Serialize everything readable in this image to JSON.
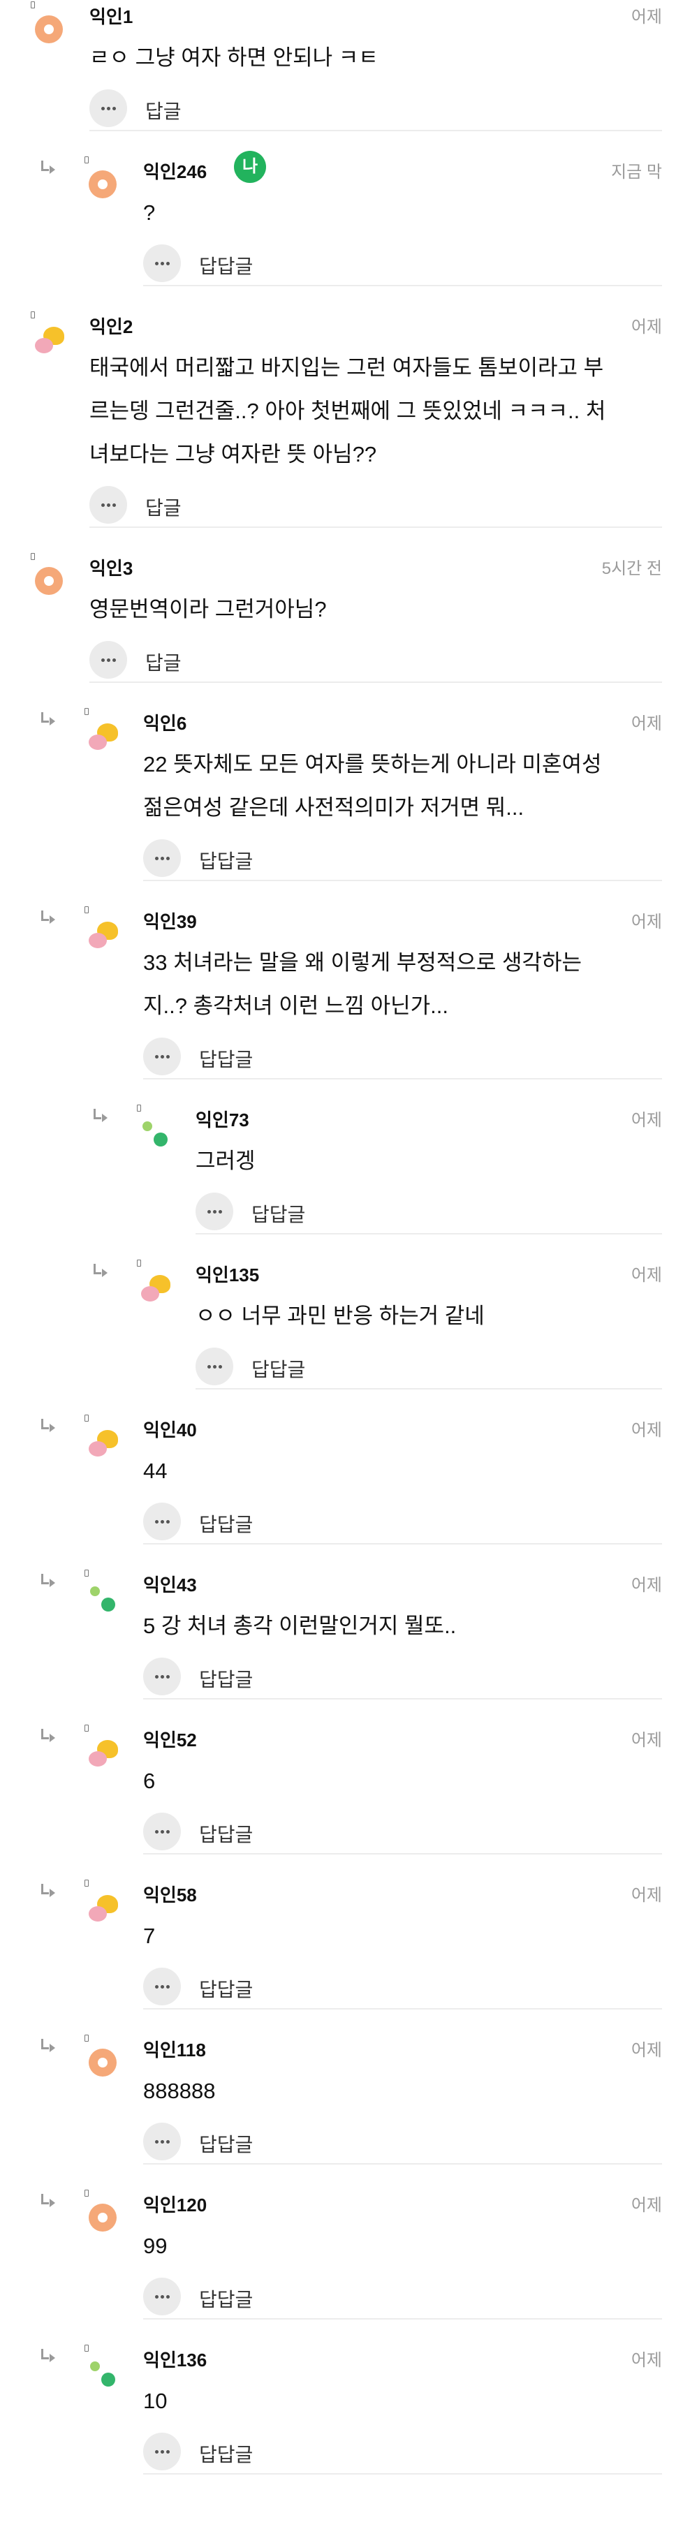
{
  "comments": [
    {
      "name": "익인1",
      "time": "어제",
      "lines": [
        "ㄹㅇ 그냥 여자 하면 안되나 ㅋㅌ"
      ],
      "level": 0,
      "avatar": "orange",
      "reply_label": "답글"
    },
    {
      "name": "익인246",
      "time": "지금 막",
      "lines": [
        "?"
      ],
      "level": 1,
      "avatar": "orange",
      "reply_label": "답답글",
      "badge": "나"
    },
    {
      "name": "익인2",
      "time": "어제",
      "lines": [
        "태국에서 머리짧고 바지입는 그런 여자들도 톰보이라고 부",
        "르는뎅 그런건줄..? 아아 첫번째에 그 뜻있었네 ㅋㅋㅋ.. 처",
        "녀보다는 그냥 여자란 뜻 아님??"
      ],
      "level": 0,
      "avatar": "yellow",
      "reply_label": "답글"
    },
    {
      "name": "익인3",
      "time": "5시간 전",
      "lines": [
        "영문번역이라 그런거아님?"
      ],
      "level": 0,
      "avatar": "orange",
      "reply_label": "답글"
    },
    {
      "name": "익인6",
      "time": "어제",
      "lines": [
        "22 뜻자체도 모든 여자를 뜻하는게 아니라 미혼여성",
        "젊은여성 같은데 사전적의미가 저거면 뭐..."
      ],
      "level": 1,
      "avatar": "yellow",
      "reply_label": "답답글"
    },
    {
      "name": "익인39",
      "time": "어제",
      "lines": [
        "33 처녀라는 말을 왜 이렇게 부정적으로 생각하는",
        "지..? 총각처녀 이런 느낌 아닌가..."
      ],
      "level": 1,
      "avatar": "yellow",
      "reply_label": "답답글"
    },
    {
      "name": "익인73",
      "time": "어제",
      "lines": [
        "그러겡"
      ],
      "level": 2,
      "avatar": "green",
      "reply_label": "답답글"
    },
    {
      "name": "익인135",
      "time": "어제",
      "lines": [
        "ㅇㅇ 너무 과민 반응 하는거 같네"
      ],
      "level": 2,
      "avatar": "yellow",
      "reply_label": "답답글"
    },
    {
      "name": "익인40",
      "time": "어제",
      "lines": [
        "44"
      ],
      "level": 1,
      "avatar": "yellow",
      "reply_label": "답답글"
    },
    {
      "name": "익인43",
      "time": "어제",
      "lines": [
        "5 강 처녀 총각 이런말인거지 뭘또.."
      ],
      "level": 1,
      "avatar": "green",
      "reply_label": "답답글"
    },
    {
      "name": "익인52",
      "time": "어제",
      "lines": [
        "6"
      ],
      "level": 1,
      "avatar": "yellow",
      "reply_label": "답답글"
    },
    {
      "name": "익인58",
      "time": "어제",
      "lines": [
        "7"
      ],
      "level": 1,
      "avatar": "yellow",
      "reply_label": "답답글"
    },
    {
      "name": "익인118",
      "time": "어제",
      "lines": [
        "888888"
      ],
      "level": 1,
      "avatar": "orange",
      "reply_label": "답답글"
    },
    {
      "name": "익인120",
      "time": "어제",
      "lines": [
        "99"
      ],
      "level": 1,
      "avatar": "orange",
      "reply_label": "답답글"
    },
    {
      "name": "익인136",
      "time": "어제",
      "lines": [
        "10"
      ],
      "level": 1,
      "avatar": "green",
      "reply_label": "답답글"
    }
  ],
  "icons": {
    "reply_arrow": "reply-arrow-icon",
    "more": "more-dots-icon",
    "avatar_orange": "orange-ring-avatar",
    "avatar_yellow": "yellow-pink-avatar",
    "avatar_green": "green-dots-avatar"
  },
  "colors": {
    "badge": "#22b35d",
    "avatar_orange": "#f5a878",
    "avatar_yellow": "#f6c12a",
    "avatar_pink": "#f2a8b8",
    "avatar_green": "#33b56b",
    "time_text": "#9b9b9b",
    "divider": "#ececec"
  }
}
